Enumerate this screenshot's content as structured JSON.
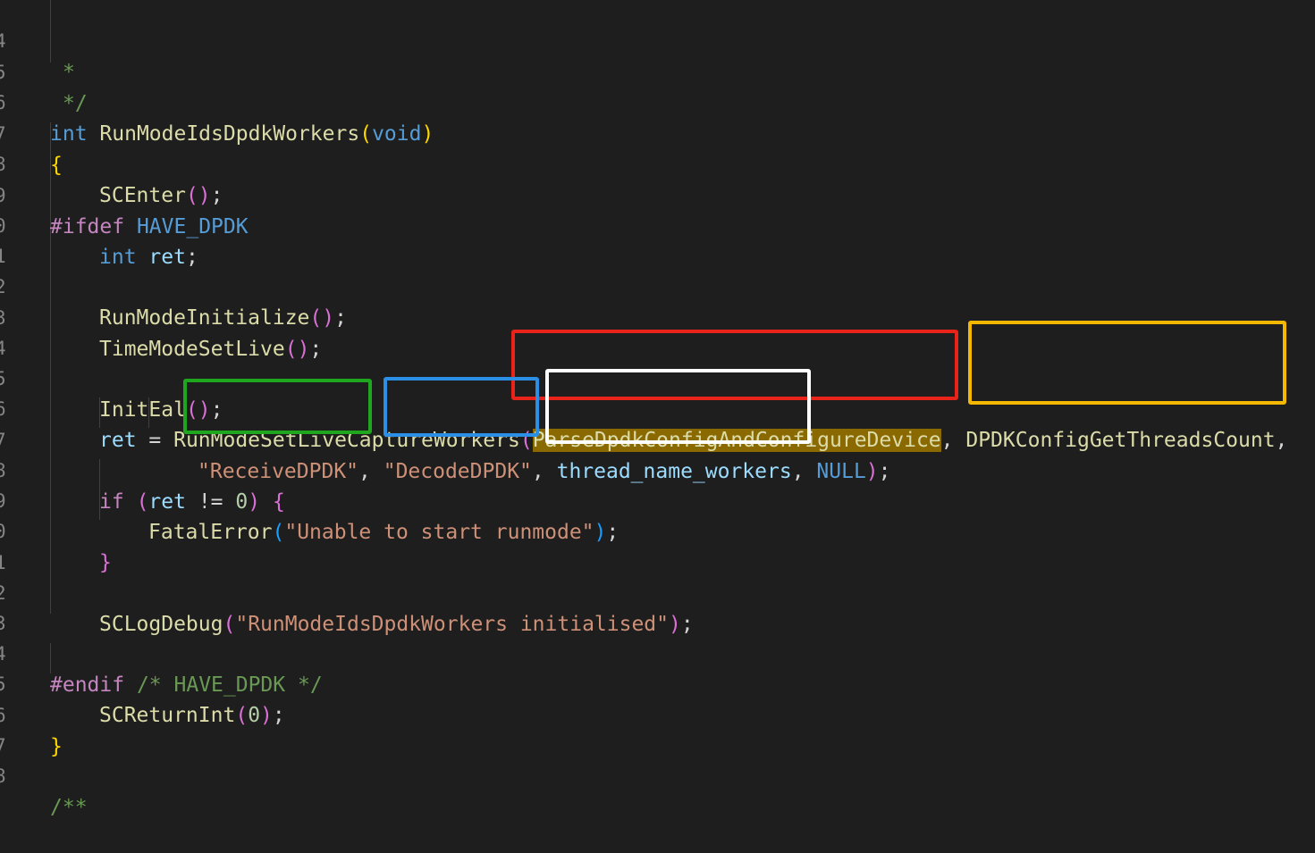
{
  "line_numbers": [
    "4",
    "5",
    "6",
    "7",
    "8",
    "9",
    "0",
    "1",
    "2",
    "3",
    "4",
    "5",
    "6",
    "7",
    "8",
    "9",
    "0",
    "1",
    "2",
    "3",
    "4",
    "5",
    "6",
    "7",
    "8"
  ],
  "code": {
    "l1_comment": "*",
    "l2_comment": "*/",
    "l3_kw": "int",
    "l3_fn": "RunModeIdsDpdkWorkers",
    "l3_param": "void",
    "l4_brace": "{",
    "l5_fn": "SCEnter",
    "l6_ifdef": "#ifdef",
    "l6_macro": "HAVE_DPDK",
    "l7_kw": "int",
    "l7_var": "ret",
    "l9_fn": "RunModeInitialize",
    "l10_fn": "TimeModeSetLive",
    "l12_fn": "InitEal",
    "l13_var": "ret",
    "l13_fn": "RunModeSetLiveCaptureWorkers",
    "l13_arg1": "ParseDpdkConfigAndConfigureDevice",
    "l13_arg2": "DPDKConfigGetThreadsCount",
    "l14_arg3": "\"ReceiveDPDK\"",
    "l14_arg4": "\"DecodeDPDK\"",
    "l14_arg5": "thread_name_workers",
    "l14_arg6": "NULL",
    "l15_kw": "if",
    "l15_var": "ret",
    "l15_op": "!=",
    "l15_num": "0",
    "l16_fn": "FatalError",
    "l16_str": "\"Unable to start runmode\"",
    "l17_brace": "}",
    "l19_fn": "SCLogDebug",
    "l19_str": "\"RunModeIdsDpdkWorkers initialised\"",
    "l21_endif": "#endif",
    "l21_comment": "/* HAVE_DPDK */",
    "l22_fn": "SCReturnInt",
    "l22_num": "0",
    "l23_brace": "}",
    "l25_comment": "/**"
  },
  "annotation_colors": {
    "red": "#e8231a",
    "orange": "#f5b800",
    "green": "#1fa61f",
    "blue": "#2b8fe6",
    "white": "#ffffff"
  }
}
